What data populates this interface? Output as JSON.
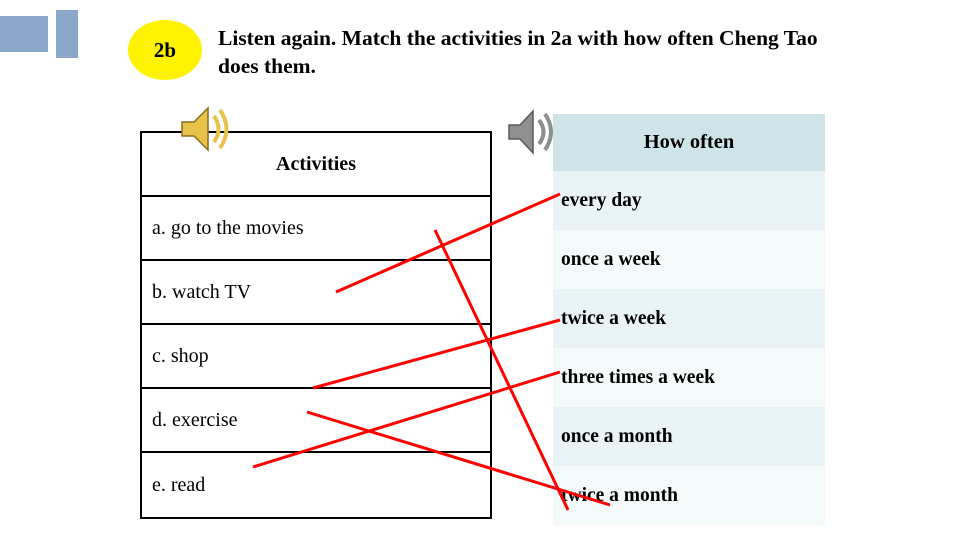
{
  "slide": {
    "badge": "2b",
    "instruction": "Listen again. Match the activities in 2a with how often Cheng Tao does them.",
    "accent_yellow": "#FFF200",
    "accent_blue": "#8BA7C9",
    "line_color": "#FF0000",
    "howoften_header_bg": "#CFE4E9"
  },
  "activities": {
    "header": "Activities",
    "items": [
      "a. go to the movies",
      "b. watch TV",
      "c. shop",
      "d. exercise",
      "e. read"
    ]
  },
  "how_often": {
    "header": "How often",
    "items": [
      "every day",
      "once a week",
      "twice a week",
      "three times a week",
      "once a month",
      "twice a month"
    ]
  },
  "icons": {
    "speaker_left": "speaker-icon",
    "speaker_right": "speaker-icon"
  }
}
